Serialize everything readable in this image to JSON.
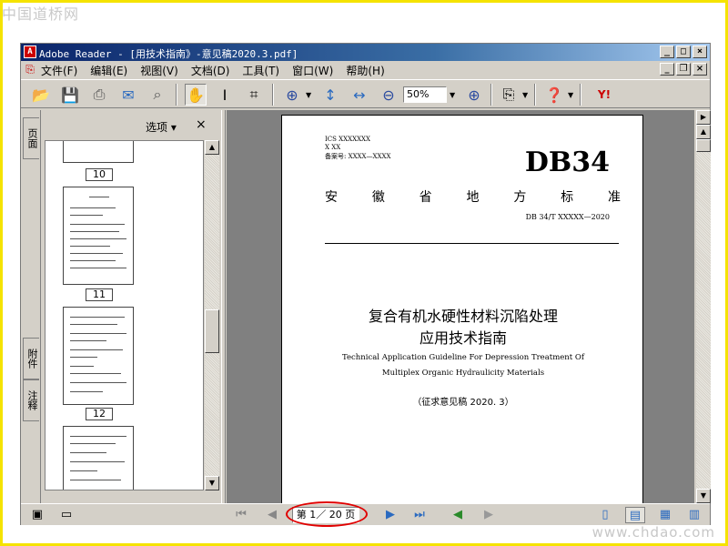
{
  "watermarks": {
    "top": "中国道桥网",
    "bottom": "www.chdao.com"
  },
  "window": {
    "title": "Adobe Reader - [用技术指南》-意见稿2020.3.pdf]",
    "app_icon_glyph": "A"
  },
  "menu": [
    "文件(F)",
    "编辑(E)",
    "视图(V)",
    "文档(D)",
    "工具(T)",
    "窗口(W)",
    "帮助(H)"
  ],
  "toolbar": {
    "zoom_value": "50%"
  },
  "navpane": {
    "options_label": "选项 ▾",
    "close_glyph": "×",
    "tabs": [
      "页面",
      "附件",
      "注释"
    ],
    "page_labels": [
      "10",
      "11",
      "12"
    ]
  },
  "document": {
    "ics": "ICS XXXXXXX",
    "cls": "X XX",
    "record": "备案号: XXXX—XXXX",
    "std": "DB34",
    "org_chars": [
      "安",
      "徽",
      "省",
      "地",
      "方",
      "标",
      "准"
    ],
    "std_number": "DB 34/T XXXXX—2020",
    "title_line1": "复合有机水硬性材料沉陷处理",
    "title_line2": "应用技术指南",
    "eng_line1": "Technical Application Guideline For Depression Treatment Of",
    "eng_line2": "Multiplex Organic Hydraulicity Materials",
    "draft": "（征求意见稿 2020. 3）"
  },
  "status": {
    "page_indicator": "第 1／ 20 页"
  }
}
